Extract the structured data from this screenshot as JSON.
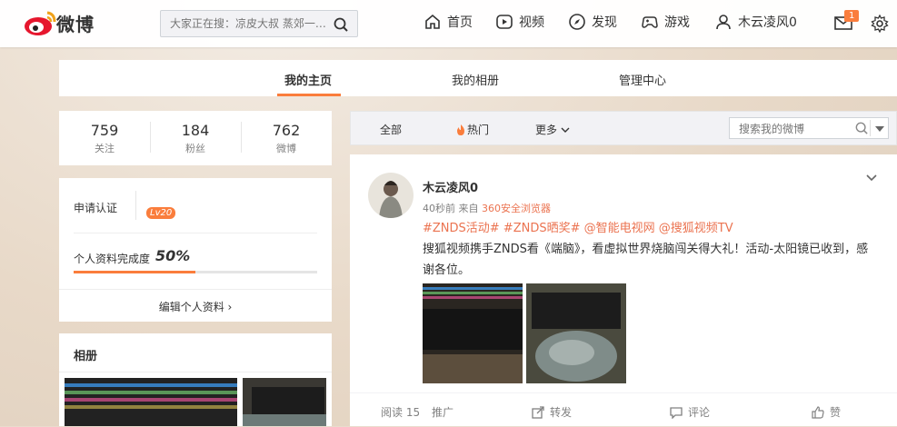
{
  "header": {
    "logo_text": "微博",
    "search_placeholder": "大家正在搜：凉皮大叔 蒸郊一…",
    "nav": [
      {
        "label": "首页"
      },
      {
        "label": "视频"
      },
      {
        "label": "发现"
      },
      {
        "label": "游戏"
      },
      {
        "label": "木云凌风0"
      }
    ],
    "mail_badge": "1"
  },
  "tabs": [
    {
      "label": "我的主页"
    },
    {
      "label": "我的相册"
    },
    {
      "label": "管理中心"
    }
  ],
  "stats": [
    {
      "value": "759",
      "label": "关注"
    },
    {
      "value": "184",
      "label": "粉丝"
    },
    {
      "value": "762",
      "label": "微博"
    }
  ],
  "profile": {
    "apply_verify": "申请认证",
    "level": "Lv20",
    "completeness_label": "个人资料完成度",
    "completeness_value": "50%",
    "completeness_fraction": 0.5,
    "edit_label": "编辑个人资料 ›"
  },
  "album": {
    "title": "相册"
  },
  "feed_header": {
    "all": "全部",
    "hot": "热门",
    "more": "更多",
    "search_placeholder": "搜索我的微博"
  },
  "post": {
    "username": "木云凌风0",
    "time": "40秒前 来自",
    "source": "360安全浏览器",
    "tags": "#ZNDS活动# #ZNDS晒奖# @智能电视网 @搜狐视频TV",
    "text": "搜狐视频携手ZNDS看《端脑》，看虚拟世界烧脑闯关得大礼！活动-太阳镜已收到，感谢各位。",
    "reads": "阅读 15",
    "promote": "推广",
    "repost": "转发",
    "comment": "评论",
    "like": "赞"
  },
  "colors": {
    "accent": "#fa7d3c",
    "link": "#eb7350"
  }
}
